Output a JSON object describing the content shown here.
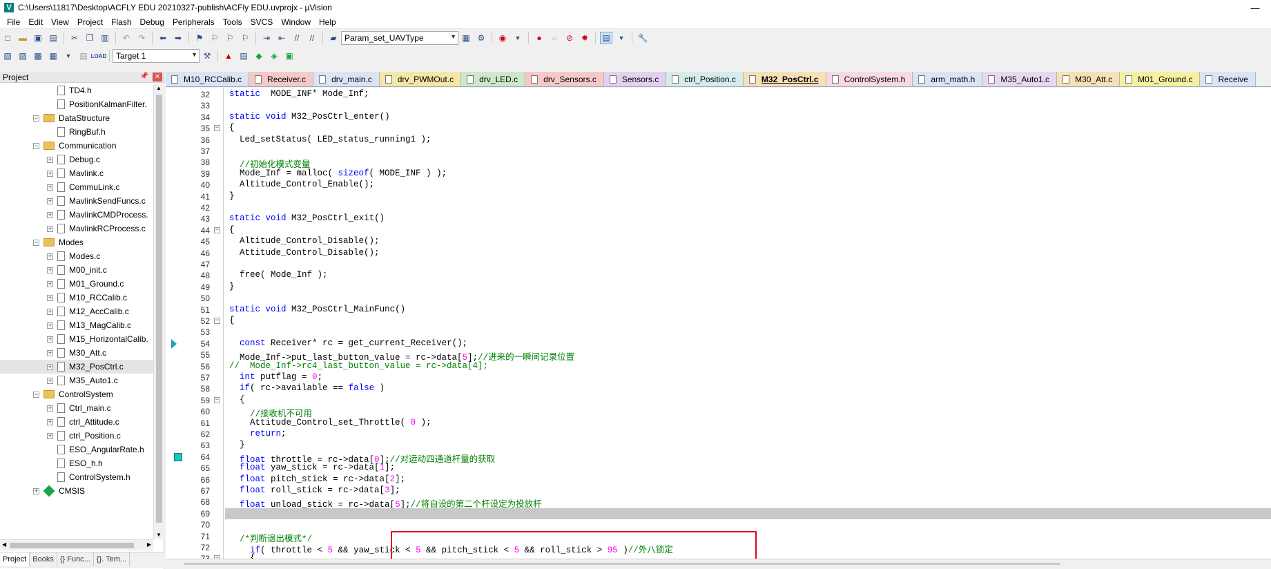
{
  "titlebar": {
    "title": "C:\\Users\\11817\\Desktop\\ACFLY EDU 20210327-publish\\ACFly EDU.uvprojx - µVision",
    "minimize": "—"
  },
  "menu": [
    "File",
    "Edit",
    "View",
    "Project",
    "Flash",
    "Debug",
    "Peripherals",
    "Tools",
    "SVCS",
    "Window",
    "Help"
  ],
  "toolbar": {
    "find_combo": "Param_set_UAVType",
    "target_combo": "Target 1"
  },
  "project_panel": {
    "title": "Project",
    "tree": [
      {
        "label": "TD4.h",
        "type": "file",
        "level": 3,
        "expander": ""
      },
      {
        "label": "PositionKalmanFilter.",
        "type": "file",
        "level": 3,
        "expander": ""
      },
      {
        "label": "DataStructure",
        "type": "folder",
        "level": 2,
        "expander": "−"
      },
      {
        "label": "RingBuf.h",
        "type": "file",
        "level": 3,
        "expander": ""
      },
      {
        "label": "Communication",
        "type": "folder",
        "level": 2,
        "expander": "−"
      },
      {
        "label": "Debug.c",
        "type": "file",
        "level": 3,
        "expander": "+"
      },
      {
        "label": "Mavlink.c",
        "type": "file",
        "level": 3,
        "expander": "+"
      },
      {
        "label": "CommuLink.c",
        "type": "file",
        "level": 3,
        "expander": "+"
      },
      {
        "label": "MavlinkSendFuncs.c",
        "type": "file",
        "level": 3,
        "expander": "+"
      },
      {
        "label": "MavlinkCMDProcess.",
        "type": "file",
        "level": 3,
        "expander": "+"
      },
      {
        "label": "MavlinkRCProcess.c",
        "type": "file",
        "level": 3,
        "expander": "+"
      },
      {
        "label": "Modes",
        "type": "folder",
        "level": 2,
        "expander": "−"
      },
      {
        "label": "Modes.c",
        "type": "file",
        "level": 3,
        "expander": "+"
      },
      {
        "label": "M00_init.c",
        "type": "file",
        "level": 3,
        "expander": "+"
      },
      {
        "label": "M01_Ground.c",
        "type": "file",
        "level": 3,
        "expander": "+"
      },
      {
        "label": "M10_RCCalib.c",
        "type": "file",
        "level": 3,
        "expander": "+"
      },
      {
        "label": "M12_AccCalib.c",
        "type": "file",
        "level": 3,
        "expander": "+"
      },
      {
        "label": "M13_MagCalib.c",
        "type": "file",
        "level": 3,
        "expander": "+"
      },
      {
        "label": "M15_HorizontalCalib.",
        "type": "file",
        "level": 3,
        "expander": "+"
      },
      {
        "label": "M30_Att.c",
        "type": "file",
        "level": 3,
        "expander": "+"
      },
      {
        "label": "M32_PosCtrl.c",
        "type": "file",
        "level": 3,
        "expander": "+",
        "selected": true
      },
      {
        "label": "M35_Auto1.c",
        "type": "file",
        "level": 3,
        "expander": "+"
      },
      {
        "label": "ControlSystem",
        "type": "folder",
        "level": 2,
        "expander": "−"
      },
      {
        "label": "Ctrl_main.c",
        "type": "file",
        "level": 3,
        "expander": "+"
      },
      {
        "label": "ctrl_Attitude.c",
        "type": "file",
        "level": 3,
        "expander": "+"
      },
      {
        "label": "ctrl_Position.c",
        "type": "file",
        "level": 3,
        "expander": "+"
      },
      {
        "label": "ESO_AngularRate.h",
        "type": "file",
        "level": 3,
        "expander": ""
      },
      {
        "label": "ESO_h.h",
        "type": "file",
        "level": 3,
        "expander": ""
      },
      {
        "label": "ControlSystem.h",
        "type": "file",
        "level": 3,
        "expander": ""
      },
      {
        "label": "CMSIS",
        "type": "gem",
        "level": 1,
        "expander": "+"
      }
    ],
    "bottom_tabs": [
      "Project",
      "Books",
      "{} Func...",
      "{}. Tem..."
    ]
  },
  "tabs": [
    {
      "label": "M10_RCCalib.c",
      "color": "#dbe4f4"
    },
    {
      "label": "Receiver.c",
      "color": "#f6c9c9"
    },
    {
      "label": "drv_main.c",
      "color": "#dbe4f4"
    },
    {
      "label": "drv_PWMOut.c",
      "color": "#f5e7a5"
    },
    {
      "label": "drv_LED.c",
      "color": "#cfe8c9"
    },
    {
      "label": "drv_Sensors.c",
      "color": "#f6c9c9"
    },
    {
      "label": "Sensors.c",
      "color": "#e2d2ef"
    },
    {
      "label": "ctrl_Position.c",
      "color": "#d4ecea"
    },
    {
      "label": "M32_PosCtrl.c",
      "color": "#f6e0b8",
      "active": true
    },
    {
      "label": "ControlSystem.h",
      "color": "#f7d9e4"
    },
    {
      "label": "arm_math.h",
      "color": "#dbe4f4"
    },
    {
      "label": "M35_Auto1.c",
      "color": "#e6d9ef"
    },
    {
      "label": "M30_Att.c",
      "color": "#f6e0b8"
    },
    {
      "label": "M01_Ground.c",
      "color": "#f6f1a0"
    },
    {
      "label": "Receive",
      "color": "#dbe4f4"
    }
  ],
  "editor": {
    "current_line": 69,
    "lines": [
      {
        "n": "32",
        "fold": "",
        "segs": [
          [
            "kw",
            "static"
          ],
          [
            "",
            "  MODE_INF* Mode_Inf;"
          ]
        ]
      },
      {
        "n": "33",
        "fold": "",
        "segs": []
      },
      {
        "n": "34",
        "fold": "",
        "segs": [
          [
            "kw",
            "static"
          ],
          [
            "",
            " "
          ],
          [
            "kw",
            "void"
          ],
          [
            "",
            " M32_PosCtrl_enter()"
          ]
        ]
      },
      {
        "n": "35",
        "fold": "−",
        "segs": [
          [
            "",
            "{"
          ]
        ]
      },
      {
        "n": "36",
        "fold": "",
        "segs": [
          [
            "",
            "  Led_setStatus( LED_status_running1 );"
          ]
        ]
      },
      {
        "n": "37",
        "fold": "",
        "segs": []
      },
      {
        "n": "38",
        "fold": "",
        "segs": [
          [
            "",
            "  "
          ],
          [
            "cm",
            "//初始化模式变量"
          ]
        ]
      },
      {
        "n": "39",
        "fold": "",
        "segs": [
          [
            "",
            "  Mode_Inf = malloc( "
          ],
          [
            "kw",
            "sizeof"
          ],
          [
            "",
            "( MODE_INF ) );"
          ]
        ]
      },
      {
        "n": "40",
        "fold": "",
        "segs": [
          [
            "",
            "  Altitude_Control_Enable();"
          ]
        ]
      },
      {
        "n": "41",
        "fold": "",
        "segs": [
          [
            "",
            "}"
          ]
        ]
      },
      {
        "n": "42",
        "fold": "",
        "segs": []
      },
      {
        "n": "43",
        "fold": "",
        "segs": [
          [
            "kw",
            "static"
          ],
          [
            "",
            " "
          ],
          [
            "kw",
            "void"
          ],
          [
            "",
            " M32_PosCtrl_exit()"
          ]
        ]
      },
      {
        "n": "44",
        "fold": "−",
        "segs": [
          [
            "",
            "{"
          ]
        ]
      },
      {
        "n": "45",
        "fold": "",
        "segs": [
          [
            "",
            "  Altitude_Control_Disable();"
          ]
        ]
      },
      {
        "n": "46",
        "fold": "",
        "segs": [
          [
            "",
            "  Attitude_Control_Disable();"
          ]
        ]
      },
      {
        "n": "47",
        "fold": "",
        "segs": []
      },
      {
        "n": "48",
        "fold": "",
        "segs": [
          [
            "",
            "  free( Mode_Inf );"
          ]
        ]
      },
      {
        "n": "49",
        "fold": "",
        "segs": [
          [
            "",
            "}"
          ]
        ]
      },
      {
        "n": "50",
        "fold": "",
        "segs": []
      },
      {
        "n": "51",
        "fold": "",
        "segs": [
          [
            "kw",
            "static"
          ],
          [
            "",
            " "
          ],
          [
            "kw",
            "void"
          ],
          [
            "",
            " M32_PosCtrl_MainFunc()"
          ]
        ]
      },
      {
        "n": "52",
        "fold": "−",
        "segs": [
          [
            "",
            "{"
          ]
        ]
      },
      {
        "n": "53",
        "fold": "",
        "segs": []
      },
      {
        "n": "54",
        "fold": "",
        "segs": [
          [
            "",
            "  "
          ],
          [
            "kw",
            "const"
          ],
          [
            "",
            " Receiver* rc = get_current_Receiver();"
          ]
        ]
      },
      {
        "n": "55",
        "fold": "",
        "segs": [
          [
            "",
            "  Mode_Inf->put_last_button_value = rc->data["
          ],
          [
            "num",
            "5"
          ],
          [
            "",
            "];"
          ],
          [
            "cm",
            "//进来的一瞬间记录位置"
          ]
        ]
      },
      {
        "n": "56",
        "fold": "",
        "segs": [
          [
            "cm",
            "//  Mode_Inf->rc4_last_button_value = rc->data[4];"
          ]
        ]
      },
      {
        "n": "57",
        "fold": "",
        "segs": [
          [
            "",
            "  "
          ],
          [
            "kw",
            "int"
          ],
          [
            "",
            " putflag = "
          ],
          [
            "num",
            "0"
          ],
          [
            "",
            ";"
          ]
        ]
      },
      {
        "n": "58",
        "fold": "",
        "segs": [
          [
            "",
            "  "
          ],
          [
            "kw",
            "if"
          ],
          [
            "",
            "( rc->available == "
          ],
          [
            "kw",
            "false"
          ],
          [
            "",
            " )"
          ]
        ]
      },
      {
        "n": "59",
        "fold": "−",
        "segs": [
          [
            "",
            "  {"
          ]
        ]
      },
      {
        "n": "60",
        "fold": "",
        "segs": [
          [
            "",
            "    "
          ],
          [
            "cm",
            "//接收机不可用"
          ]
        ]
      },
      {
        "n": "61",
        "fold": "",
        "segs": [
          [
            "",
            "    Attitude_Control_set_Throttle( "
          ],
          [
            "num",
            "0"
          ],
          [
            "",
            " );"
          ]
        ]
      },
      {
        "n": "62",
        "fold": "",
        "segs": [
          [
            "",
            "    "
          ],
          [
            "kw",
            "return"
          ],
          [
            "",
            ";"
          ]
        ]
      },
      {
        "n": "63",
        "fold": "",
        "segs": [
          [
            "",
            "  }"
          ]
        ]
      },
      {
        "n": "64",
        "fold": "",
        "segs": [
          [
            "",
            "  "
          ],
          [
            "kw",
            "float"
          ],
          [
            "",
            " throttle = rc->data["
          ],
          [
            "num",
            "0"
          ],
          [
            "",
            "];"
          ],
          [
            "cm",
            "//对运动四通道杆量的获取"
          ]
        ]
      },
      {
        "n": "65",
        "fold": "",
        "segs": [
          [
            "",
            "  "
          ],
          [
            "kw",
            "float"
          ],
          [
            "",
            " yaw_stick = rc->data["
          ],
          [
            "num",
            "1"
          ],
          [
            "",
            "];"
          ]
        ]
      },
      {
        "n": "66",
        "fold": "",
        "segs": [
          [
            "",
            "  "
          ],
          [
            "kw",
            "float"
          ],
          [
            "",
            " pitch_stick = rc->data["
          ],
          [
            "num",
            "2"
          ],
          [
            "",
            "];"
          ]
        ]
      },
      {
        "n": "67",
        "fold": "",
        "segs": [
          [
            "",
            "  "
          ],
          [
            "kw",
            "float"
          ],
          [
            "",
            " roll_stick = rc->data["
          ],
          [
            "num",
            "3"
          ],
          [
            "",
            "];"
          ]
        ]
      },
      {
        "n": "68",
        "fold": "",
        "segs": [
          [
            "",
            "  "
          ],
          [
            "kw",
            "float"
          ],
          [
            "",
            " unload_stick = rc->data["
          ],
          [
            "num",
            "5"
          ],
          [
            "",
            "];"
          ],
          [
            "cm",
            "//将自设的第二个杆设定为投放杆"
          ]
        ]
      },
      {
        "n": "69",
        "fold": "",
        "segs": [
          [
            "",
            "  "
          ]
        ]
      },
      {
        "n": "70",
        "fold": "",
        "segs": []
      },
      {
        "n": "71",
        "fold": "",
        "segs": [
          [
            "",
            "  "
          ],
          [
            "cm",
            "/*判断退出模式*/"
          ]
        ]
      },
      {
        "n": "72",
        "fold": "",
        "segs": [
          [
            "",
            "    "
          ],
          [
            "kw",
            "if"
          ],
          [
            "",
            "( throttle < "
          ],
          [
            "num",
            "5"
          ],
          [
            "",
            " && yaw_stick < "
          ],
          [
            "num",
            "5"
          ],
          [
            "",
            " && pitch_stick < "
          ],
          [
            "num",
            "5"
          ],
          [
            "",
            " && roll_stick > "
          ],
          [
            "num",
            "95"
          ],
          [
            "",
            " )"
          ],
          [
            "cm",
            "//外八锁定"
          ]
        ]
      },
      {
        "n": "73",
        "fold": "−",
        "segs": [
          [
            "",
            "    {"
          ]
        ]
      }
    ]
  }
}
